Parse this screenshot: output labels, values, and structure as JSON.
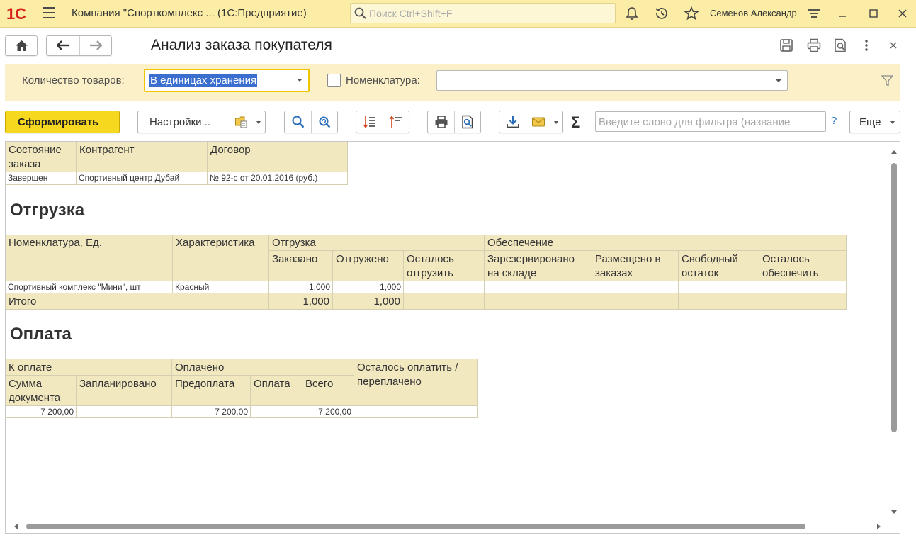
{
  "titlebar": {
    "logo_text": "1С",
    "app_title": "Компания \"Спорткомплекс ...   (1С:Предприятие)",
    "search_placeholder": "Поиск Ctrl+Shift+F",
    "user_name": "Семенов Александр"
  },
  "form": {
    "title": "Анализ заказа покупателя"
  },
  "params": {
    "qty_label": "Количество товаров:",
    "qty_value": "В единицах хранения",
    "nom_label": "Номенклатура:",
    "nom_value": "",
    "nom_checked": false
  },
  "toolbar": {
    "generate_label": "Сформировать",
    "settings_label": "Настройки...",
    "filter_placeholder": "Введите слово для фильтра (название",
    "help_label": "?",
    "more_label": "Еще"
  },
  "report": {
    "header_table": {
      "columns": [
        "Состояние заказа",
        "Контрагент",
        "Договор"
      ],
      "columns_wrapped": [
        [
          "Состояние",
          "заказа"
        ],
        [
          "Контрагент"
        ],
        [
          "Договор"
        ]
      ],
      "row": [
        "Завершен",
        "Спортивный центр Дубай",
        "№ 92-с от 20.01.2016 (руб.)"
      ]
    },
    "shipment": {
      "title": "Отгрузка",
      "col_nom": "Номенклатура, Ед.",
      "col_char": "Характеристика",
      "group_shipment": "Отгрузка",
      "group_provision": "Обеспечение",
      "sub_shipment": [
        [
          "Заказано"
        ],
        [
          "Отгружено"
        ],
        [
          "Осталось",
          "отгрузить"
        ]
      ],
      "sub_provision": [
        [
          "Зарезервировано",
          "на складе"
        ],
        [
          "Размещено в",
          "заказах"
        ],
        [
          "Свободный",
          "остаток"
        ],
        [
          "Осталось",
          "обеспечить"
        ]
      ],
      "row": {
        "nom": "Спортивный комплекс \"Мини\", шт",
        "char": "Красный",
        "ordered": "1,000",
        "shipped": "1,000"
      },
      "total": {
        "label": "Итого",
        "ordered": "1,000",
        "shipped": "1,000"
      }
    },
    "payment": {
      "title": "Оплата",
      "group_to_pay": "К оплате",
      "group_paid": "Оплачено",
      "remaining": [
        "Осталось оплатить /",
        "переплачено"
      ],
      "sub_to_pay": [
        [
          "Сумма",
          "документа"
        ],
        [
          "Запланировано"
        ]
      ],
      "sub_paid": [
        [
          "Предоплата"
        ],
        [
          "Оплата"
        ],
        [
          "Всего"
        ]
      ],
      "row": {
        "doc_sum": "7 200,00",
        "planned": "",
        "prepayment": "7 200,00",
        "payment": "",
        "total": "7 200,00",
        "remaining": ""
      }
    }
  },
  "colors": {
    "titlebar_bg": "#fbeda5",
    "params_bg": "#fbf0c8",
    "table_header_bg": "#f2e8c0",
    "primary_button": "#f6d81e",
    "selection": "#3a6fd0"
  }
}
